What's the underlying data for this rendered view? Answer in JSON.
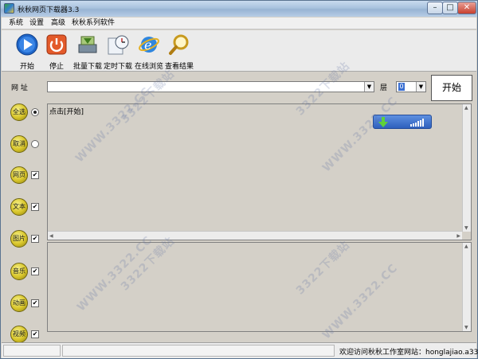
{
  "window": {
    "title": "秋秋网页下载器3.3"
  },
  "menu": [
    "系统",
    "设置",
    "高级",
    "秋秋系列软件"
  ],
  "toolbar": {
    "start": "开始",
    "stop": "停止",
    "batch": "批量下载",
    "scheduled": "定时下载",
    "browse": "在线浏览",
    "view": "查看结果"
  },
  "url_row": {
    "label": "网 址",
    "value": "",
    "layer_label": "层",
    "layer_value": "0",
    "start_button": "开始"
  },
  "categories": [
    {
      "label": "全选",
      "control": "radio",
      "checked": true
    },
    {
      "label": "取消",
      "control": "radio",
      "checked": false
    },
    {
      "label": "网页",
      "control": "checkbox",
      "checked": true
    },
    {
      "label": "文本",
      "control": "checkbox",
      "checked": true
    },
    {
      "label": "图片",
      "control": "checkbox",
      "checked": true
    },
    {
      "label": "音乐",
      "control": "checkbox",
      "checked": true
    },
    {
      "label": "动画",
      "control": "checkbox",
      "checked": true
    },
    {
      "label": "视频",
      "control": "checkbox",
      "checked": true
    }
  ],
  "log_panel": {
    "text": "点击[开始]"
  },
  "status": {
    "text": "欢迎访问秋秋工作室网站：honglajiao.a33"
  },
  "watermark": "WWW.3322.CC",
  "watermark_cn": "3322下载站",
  "colors": {
    "title_bar": "#a9c2de",
    "accent_blue": "#3a6fd1",
    "category_ball": "#d8c52a",
    "window_bg": "#d4d0c8"
  }
}
